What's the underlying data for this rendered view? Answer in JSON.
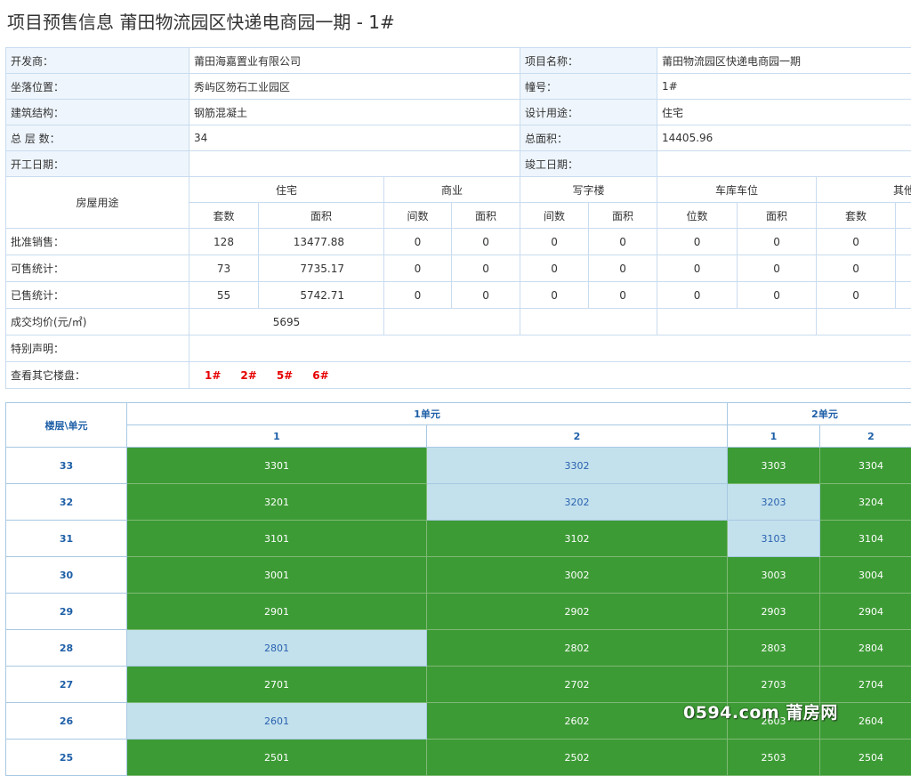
{
  "page": {
    "title": "项目预售信息 莆田物流园区快递电商园一期 - 1#"
  },
  "info": {
    "developer_label": "开发商：",
    "developer": "莆田海嘉置业有限公司",
    "project_label": "项目名称：",
    "project": "莆田物流园区快递电商园一期",
    "location_label": "坐落位置：",
    "location": "秀屿区笏石工业园区",
    "building_label": "幢号：",
    "building": "1#",
    "structure_label": "建筑结构：",
    "structure": "钢筋混凝土",
    "usage_label": "设计用途：",
    "usage": "住宅",
    "floors_label": "总 层 数：",
    "floors": "34",
    "area_label": "总面积：",
    "area": "14405.96",
    "start_label": "开工日期：",
    "start": "",
    "finish_label": "竣工日期：",
    "finish": ""
  },
  "usage_table": {
    "row_header": "房屋用途",
    "groups": [
      "住宅",
      "商业",
      "写字楼",
      "车库车位",
      "其他"
    ],
    "sub_headers": [
      "套数",
      "面积",
      "间数",
      "面积",
      "间数",
      "面积",
      "位数",
      "面积",
      "套数"
    ],
    "rows": [
      {
        "label": "批准销售：",
        "values": [
          "128",
          "13477.88",
          "0",
          "0",
          "0",
          "0",
          "0",
          "0",
          "0"
        ]
      },
      {
        "label": "可售统计：",
        "values": [
          "73",
          "7735.17",
          "0",
          "0",
          "0",
          "0",
          "0",
          "0",
          "0"
        ]
      },
      {
        "label": "已售统计：",
        "values": [
          "55",
          "5742.71",
          "0",
          "0",
          "0",
          "0",
          "0",
          "0",
          "0"
        ]
      }
    ],
    "avg_price_label": "成交均价(元/㎡)",
    "avg_price": "5695",
    "notes_label": "特别声明：",
    "notes": "",
    "other_label": "查看其它楼盘：",
    "other_buildings": [
      "1#",
      "2#",
      "5#",
      "6#"
    ]
  },
  "units": {
    "corner": "楼层\\单元",
    "unit_groups": [
      "1单元",
      "2单元"
    ],
    "sub": [
      "1",
      "2",
      "1",
      "2"
    ],
    "legend_colors": {
      "available": "#3d9b35",
      "sold": "#c3e1ec"
    },
    "floors": [
      {
        "floor": "33",
        "rooms": [
          [
            "3301",
            "g"
          ],
          [
            "3302",
            "b"
          ],
          [
            "3303",
            "g"
          ],
          [
            "3304",
            "g"
          ]
        ]
      },
      {
        "floor": "32",
        "rooms": [
          [
            "3201",
            "g"
          ],
          [
            "3202",
            "b"
          ],
          [
            "3203",
            "b"
          ],
          [
            "3204",
            "g"
          ]
        ]
      },
      {
        "floor": "31",
        "rooms": [
          [
            "3101",
            "g"
          ],
          [
            "3102",
            "g"
          ],
          [
            "3103",
            "b"
          ],
          [
            "3104",
            "g"
          ]
        ]
      },
      {
        "floor": "30",
        "rooms": [
          [
            "3001",
            "g"
          ],
          [
            "3002",
            "g"
          ],
          [
            "3003",
            "g"
          ],
          [
            "3004",
            "g"
          ]
        ]
      },
      {
        "floor": "29",
        "rooms": [
          [
            "2901",
            "g"
          ],
          [
            "2902",
            "g"
          ],
          [
            "2903",
            "g"
          ],
          [
            "2904",
            "g"
          ]
        ]
      },
      {
        "floor": "28",
        "rooms": [
          [
            "2801",
            "b"
          ],
          [
            "2802",
            "g"
          ],
          [
            "2803",
            "g"
          ],
          [
            "2804",
            "g"
          ]
        ]
      },
      {
        "floor": "27",
        "rooms": [
          [
            "2701",
            "g"
          ],
          [
            "2702",
            "g"
          ],
          [
            "2703",
            "g"
          ],
          [
            "2704",
            "g"
          ]
        ]
      },
      {
        "floor": "26",
        "rooms": [
          [
            "2601",
            "b"
          ],
          [
            "2602",
            "g"
          ],
          [
            "2603",
            "g"
          ],
          [
            "2604",
            "g"
          ]
        ]
      },
      {
        "floor": "25",
        "rooms": [
          [
            "2501",
            "g"
          ],
          [
            "2502",
            "g"
          ],
          [
            "2503",
            "g"
          ],
          [
            "2504",
            "g"
          ]
        ]
      }
    ]
  },
  "watermark": "0594.com 莆房网"
}
